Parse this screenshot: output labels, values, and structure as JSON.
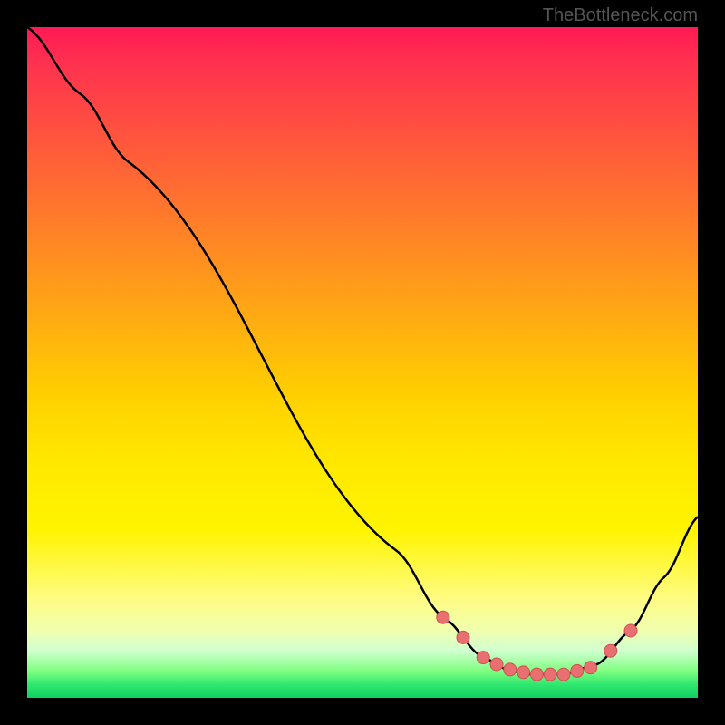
{
  "watermark": "TheBottleneck.com",
  "chart_data": {
    "type": "line",
    "title": "",
    "xlabel": "",
    "ylabel": "",
    "xlim": [
      0,
      100
    ],
    "ylim": [
      0,
      100
    ],
    "curve_points": [
      {
        "x": 0,
        "y": 100
      },
      {
        "x": 8,
        "y": 90
      },
      {
        "x": 15,
        "y": 80
      },
      {
        "x": 55,
        "y": 22
      },
      {
        "x": 62,
        "y": 12
      },
      {
        "x": 68,
        "y": 6
      },
      {
        "x": 72,
        "y": 4
      },
      {
        "x": 75,
        "y": 3.5
      },
      {
        "x": 80,
        "y": 3.5
      },
      {
        "x": 85,
        "y": 5
      },
      {
        "x": 90,
        "y": 10
      },
      {
        "x": 95,
        "y": 18
      },
      {
        "x": 100,
        "y": 27
      }
    ],
    "data_markers": [
      {
        "x": 62,
        "y": 12
      },
      {
        "x": 65,
        "y": 9
      },
      {
        "x": 68,
        "y": 6
      },
      {
        "x": 70,
        "y": 5
      },
      {
        "x": 72,
        "y": 4.2
      },
      {
        "x": 74,
        "y": 3.8
      },
      {
        "x": 76,
        "y": 3.5
      },
      {
        "x": 78,
        "y": 3.5
      },
      {
        "x": 80,
        "y": 3.5
      },
      {
        "x": 82,
        "y": 4
      },
      {
        "x": 84,
        "y": 4.5
      },
      {
        "x": 87,
        "y": 7
      },
      {
        "x": 90,
        "y": 10
      }
    ],
    "gradient_description": "vertical rainbow gradient from red (top/high) through orange, yellow to green (bottom/low) representing bottleneck severity"
  }
}
